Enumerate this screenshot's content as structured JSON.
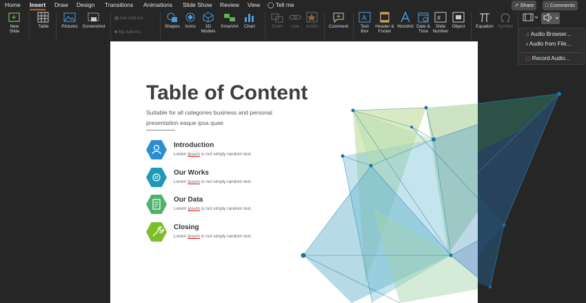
{
  "menu": {
    "tabs": [
      "Home",
      "Insert",
      "Draw",
      "Design",
      "Transitions",
      "Animations",
      "Slide Show",
      "Review",
      "View"
    ],
    "tell_me": "Tell me",
    "share": "Share",
    "comments": "Comments"
  },
  "ribbon": {
    "new_slide": "New Slide",
    "table": "Table",
    "pictures": "Pictures",
    "screenshot": "Screenshot",
    "get_addins": "Get Add-ins",
    "my_addins": "My Add-ins",
    "shapes": "Shapes",
    "icons": "Icons",
    "models_3d": "3D Models",
    "smartart": "SmartArt",
    "chart": "Chart",
    "zoom": "Zoom",
    "link": "Link",
    "action": "Action",
    "comment": "Comment",
    "text_box": "Text Box",
    "header_footer": "Header & Footer",
    "wordart": "WordArt",
    "date_time": "Date & Time",
    "slide_number": "Slide Number",
    "object": "Object",
    "equation": "Equation",
    "symbol": "Symbol"
  },
  "audio_menu": {
    "audio_browser": "Audio Browser...",
    "audio_from_file": "Audio from File...",
    "record_audio": "Record Audio..."
  },
  "slide": {
    "title": "Table of Content",
    "subtitle": "Suitable for all categories business and personal presentation eaque ipsa quae",
    "items": [
      {
        "title": "Introduction",
        "desc_pre": "Lorem ",
        "desc_u": "Ipsum",
        "desc_post": " is not simply random text.",
        "color": "#2a8fd0",
        "icon": "user-icon"
      },
      {
        "title": "Our Works",
        "desc_pre": "Lorem ",
        "desc_u": "Ipsum",
        "desc_post": " is not simply random text.",
        "color": "#1e9ab8",
        "icon": "gear-icon"
      },
      {
        "title": "Our Data",
        "desc_pre": "Lorem ",
        "desc_u": "Ipsum",
        "desc_post": " is not simply random text.",
        "color": "#4db36a",
        "icon": "document-icon"
      },
      {
        "title": "Closing",
        "desc_pre": "Lorem ",
        "desc_u": "Ipsum",
        "desc_post": " is not simply random text.",
        "color": "#7dbd2a",
        "icon": "wrench-icon"
      }
    ]
  }
}
